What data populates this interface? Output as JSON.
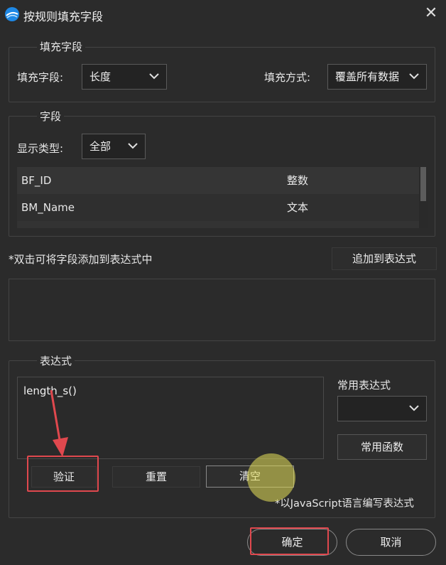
{
  "window": {
    "title": "按规则填充字段",
    "close_label": "✕"
  },
  "fill_group": {
    "title": "填充字段",
    "field_label": "填充字段:",
    "field_value": "长度",
    "mode_label": "填充方式:",
    "mode_value": "覆盖所有数据"
  },
  "field_group": {
    "title": "字段",
    "type_label": "显示类型:",
    "type_value": "全部",
    "rows": [
      {
        "name": "BF_ID",
        "type": "整数"
      },
      {
        "name": "BM_Name",
        "type": "文本"
      }
    ]
  },
  "hint": "*双击可将字段添加到表达式中",
  "add_button": "追加到表达式",
  "expression_group": {
    "title": "表达式",
    "expression": "length_s()",
    "common_expr_label": "常用表达式",
    "common_expr_value": "",
    "common_func_button": "常用函数",
    "validate_button": "验证",
    "reset_button": "重置",
    "clear_button": "清空",
    "note": "*以JavaScript语言编写表达式"
  },
  "footer": {
    "ok_button": "确定",
    "cancel_button": "取消"
  },
  "colors": {
    "highlight": "#e0484e",
    "background": "#2b2b2b",
    "accent": "#1e88e5"
  }
}
